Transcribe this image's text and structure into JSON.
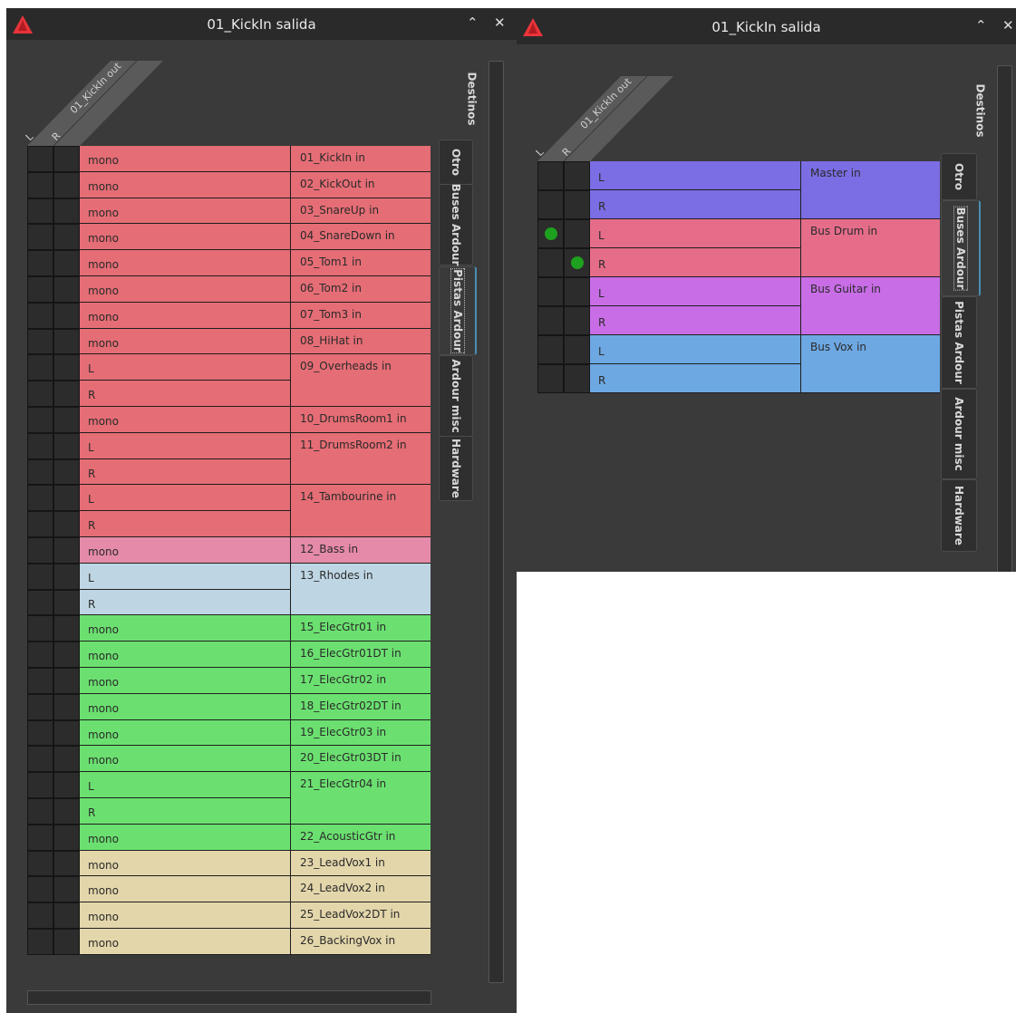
{
  "window_title": "01_KickIn salida",
  "source": {
    "label": "01_KickIn out",
    "channels": [
      "L",
      "R"
    ]
  },
  "destinations_label": "Destinos",
  "tabs": [
    "Otro",
    "Buses Ardour",
    "Pistas Ardour",
    "Ardour misc",
    "Hardware"
  ],
  "window_left": {
    "active_tab": "Pistas Ardour",
    "tracks": [
      {
        "name": "01_KickIn in",
        "channels": [
          "mono"
        ],
        "color": "#e56d75"
      },
      {
        "name": "02_KickOut in",
        "channels": [
          "mono"
        ],
        "color": "#e56d75"
      },
      {
        "name": "03_SnareUp in",
        "channels": [
          "mono"
        ],
        "color": "#e56d75"
      },
      {
        "name": "04_SnareDown in",
        "channels": [
          "mono"
        ],
        "color": "#e56d75"
      },
      {
        "name": "05_Tom1 in",
        "channels": [
          "mono"
        ],
        "color": "#e56d75"
      },
      {
        "name": "06_Tom2 in",
        "channels": [
          "mono"
        ],
        "color": "#e56d75"
      },
      {
        "name": "07_Tom3 in",
        "channels": [
          "mono"
        ],
        "color": "#e56d75"
      },
      {
        "name": "08_HiHat in",
        "channels": [
          "mono"
        ],
        "color": "#e56d75"
      },
      {
        "name": "09_Overheads in",
        "channels": [
          "L",
          "R"
        ],
        "color": "#e56d75"
      },
      {
        "name": "10_DrumsRoom1 in",
        "channels": [
          "mono"
        ],
        "color": "#e56d75"
      },
      {
        "name": "11_DrumsRoom2 in",
        "channels": [
          "L",
          "R"
        ],
        "color": "#e56d75"
      },
      {
        "name": "14_Tambourine in",
        "channels": [
          "L",
          "R"
        ],
        "color": "#e56d75"
      },
      {
        "name": "12_Bass in",
        "channels": [
          "mono"
        ],
        "color": "#e58aa8"
      },
      {
        "name": "13_Rhodes in",
        "channels": [
          "L",
          "R"
        ],
        "color": "#bed6e3"
      },
      {
        "name": "15_ElecGtr01 in",
        "channels": [
          "mono"
        ],
        "color": "#6be070"
      },
      {
        "name": "16_ElecGtr01DT in",
        "channels": [
          "mono"
        ],
        "color": "#6be070"
      },
      {
        "name": "17_ElecGtr02 in",
        "channels": [
          "mono"
        ],
        "color": "#6be070"
      },
      {
        "name": "18_ElecGtr02DT in",
        "channels": [
          "mono"
        ],
        "color": "#6be070"
      },
      {
        "name": "19_ElecGtr03 in",
        "channels": [
          "mono"
        ],
        "color": "#6be070"
      },
      {
        "name": "20_ElecGtr03DT in",
        "channels": [
          "mono"
        ],
        "color": "#6be070"
      },
      {
        "name": "21_ElecGtr04 in",
        "channels": [
          "L",
          "R"
        ],
        "color": "#6be070"
      },
      {
        "name": "22_AcousticGtr in",
        "channels": [
          "mono"
        ],
        "color": "#6be070"
      },
      {
        "name": "23_LeadVox1 in",
        "channels": [
          "mono"
        ],
        "color": "#e3d6ab"
      },
      {
        "name": "24_LeadVox2 in",
        "channels": [
          "mono"
        ],
        "color": "#e3d6ab"
      },
      {
        "name": "25_LeadVox2DT in",
        "channels": [
          "mono"
        ],
        "color": "#e3d6ab"
      },
      {
        "name": "26_BackingVox in",
        "channels": [
          "mono"
        ],
        "color": "#e3d6ab"
      }
    ]
  },
  "window_right": {
    "active_tab": "Buses Ardour",
    "tracks": [
      {
        "name": "Master in",
        "channels": [
          "L",
          "R"
        ],
        "color": "#7b6de3",
        "connected": [
          false,
          false
        ]
      },
      {
        "name": "Bus Drum in",
        "channels": [
          "L",
          "R"
        ],
        "color": "#e56d8a",
        "connected": [
          true,
          true
        ]
      },
      {
        "name": "Bus Guitar in",
        "channels": [
          "L",
          "R"
        ],
        "color": "#c86de6",
        "connected": [
          false,
          false
        ]
      },
      {
        "name": "Bus Vox in",
        "channels": [
          "L",
          "R"
        ],
        "color": "#6da8e3",
        "connected": [
          false,
          false
        ]
      }
    ]
  }
}
